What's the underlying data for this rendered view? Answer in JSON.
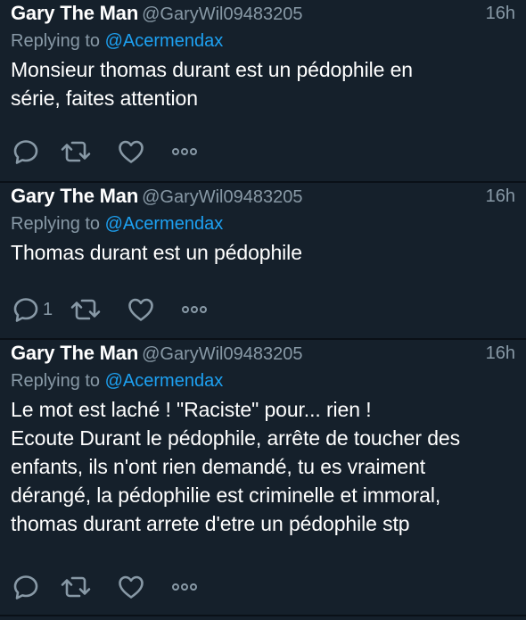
{
  "tweets": [
    {
      "name": "Gary The Man",
      "handle": "@GaryWil09483205",
      "time": "16h",
      "replying_prefix": "Replying to ",
      "replying_to": "@Acermendax",
      "text": "Monsieur thomas durant est un pédophile en\nsérie, faites attention",
      "reply_count": "",
      "icons": [
        "reply-icon",
        "retweet-icon",
        "like-icon",
        "more-icon"
      ]
    },
    {
      "name": "Gary The Man",
      "handle": "@GaryWil09483205",
      "time": "16h",
      "replying_prefix": "Replying to ",
      "replying_to": "@Acermendax",
      "text": "Thomas durant est un pédophile",
      "reply_count": "1",
      "icons": [
        "reply-icon",
        "retweet-icon",
        "like-icon",
        "more-icon"
      ]
    },
    {
      "name": "Gary The Man",
      "handle": "@GaryWil09483205",
      "time": "16h",
      "replying_prefix": "Replying to ",
      "replying_to": "@Acermendax",
      "text": "Le mot est laché ! \"Raciste\" pour... rien !\nEcoute Durant le pédophile, arrête de toucher des\nenfants, ils n'ont rien demandé, tu es vraiment\ndérangé, la pédophilie est criminelle et immoral,\nthomas durant arrete d'etre un pédophile stp",
      "reply_count": "",
      "icons": [
        "reply-icon",
        "retweet-icon",
        "like-icon",
        "more-icon"
      ]
    }
  ],
  "colors": {
    "background": "#15202b",
    "separator": "#0a1017",
    "secondary_text": "#8899a6",
    "mention": "#1da1f2",
    "primary_text": "#ffffff"
  }
}
